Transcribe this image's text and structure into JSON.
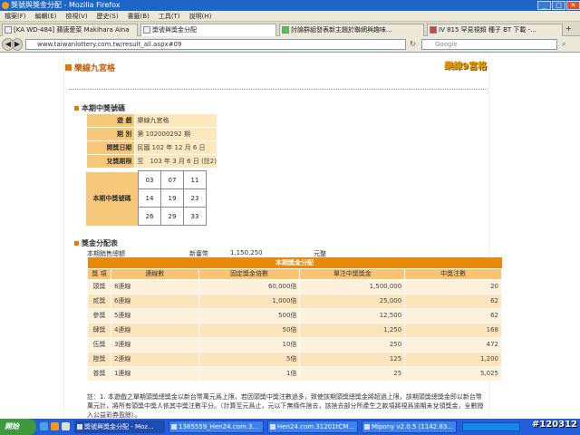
{
  "window": {
    "title": "獎號與獎金分配 - Mozilla Firefox",
    "menu": [
      "檔案(F)",
      "編輯(E)",
      "檢視(V)",
      "歷史(S)",
      "書籤(B)",
      "工具(T)",
      "說明(H)"
    ],
    "min": "_",
    "max": "□",
    "close": "✕"
  },
  "tabs": [
    {
      "label": "[KA WD-484] 蘋唐愛菜 Makihara Aina"
    },
    {
      "label": "獎號與獎金分配"
    },
    {
      "label": "討論群組發表新主題於聯網與趣味..."
    },
    {
      "label": "IV 815 罕見視頻 種子 BT 下載 -..."
    }
  ],
  "nav": {
    "back": "◀",
    "forward": "▶",
    "url": "www.taiwanlottery.com.tw/result_all.aspx#09",
    "search_placeholder": "Google"
  },
  "page": {
    "title": "樂線九宮格",
    "logo": "樂線9宮格",
    "section_winning": "本期中獎號碼",
    "info": [
      {
        "label": "遊 戲",
        "value": "樂線九宮格"
      },
      {
        "label": "期 別",
        "value": "第 102000292 期"
      },
      {
        "label": "開獎日期",
        "value": "民國 102 年 12 月 6 日"
      },
      {
        "label": "兌獎期限",
        "value": "至　103 年 3 月 6 日 (註2)"
      }
    ],
    "winning_label": "本期中獎號碼",
    "grid": [
      [
        "03",
        "07",
        "11"
      ],
      [
        "14",
        "19",
        "23"
      ],
      [
        "26",
        "29",
        "33"
      ]
    ],
    "section_prize": "獎金分配表",
    "sales_label": "本期銷售總額",
    "sales_currency": "新臺幣",
    "sales_value": "1,150,250",
    "sales_unit": "元整",
    "prize_table_title": "本期獎金分配",
    "prize_headers": [
      "獎 項",
      "連線數",
      "固定獎金倍數",
      "單注中獎獎金",
      "中獎注數"
    ],
    "prize_rows": [
      [
        "頭獎",
        "8連線",
        "60,000倍",
        "1,500,000",
        "20"
      ],
      [
        "貳獎",
        "6連線",
        "1,000倍",
        "25,000",
        "62"
      ],
      [
        "參獎",
        "5連線",
        "500倍",
        "12,500",
        "62"
      ],
      [
        "肆獎",
        "4連線",
        "50倍",
        "1,250",
        "168"
      ],
      [
        "伍獎",
        "3連線",
        "10倍",
        "250",
        "472"
      ],
      [
        "陸獎",
        "2連線",
        "5倍",
        "125",
        "1,200"
      ],
      [
        "普獎",
        "1連線",
        "1倍",
        "25",
        "5,025"
      ]
    ],
    "note": "註：1. 本遊戲之單期頭獎總獎金以新台幣萬元爲上限，若因頭獎中獎注數過多，致使該期頭獎總獎金將超過上限，該期頭獎總獎金即以新台幣萬元計，將所有頭獎中獎人依其中獎注數平分。（計算至元爲止，元以下無條件捨去，該捨去部分所產生之款項將視爲逾期未兌領獎金，全數撥入公益彩券盈餘）。"
  },
  "taskbar": {
    "start": "開始",
    "tasks": [
      {
        "label": "獎號與獎金分配 - Moz..."
      },
      {
        "label": "1385559_Hen24.com.3..."
      },
      {
        "label": "Hen24.com.31201tCM..."
      },
      {
        "label": "Mipony v2.0.5 (1142.83..."
      }
    ],
    "watermark": "#120312"
  }
}
